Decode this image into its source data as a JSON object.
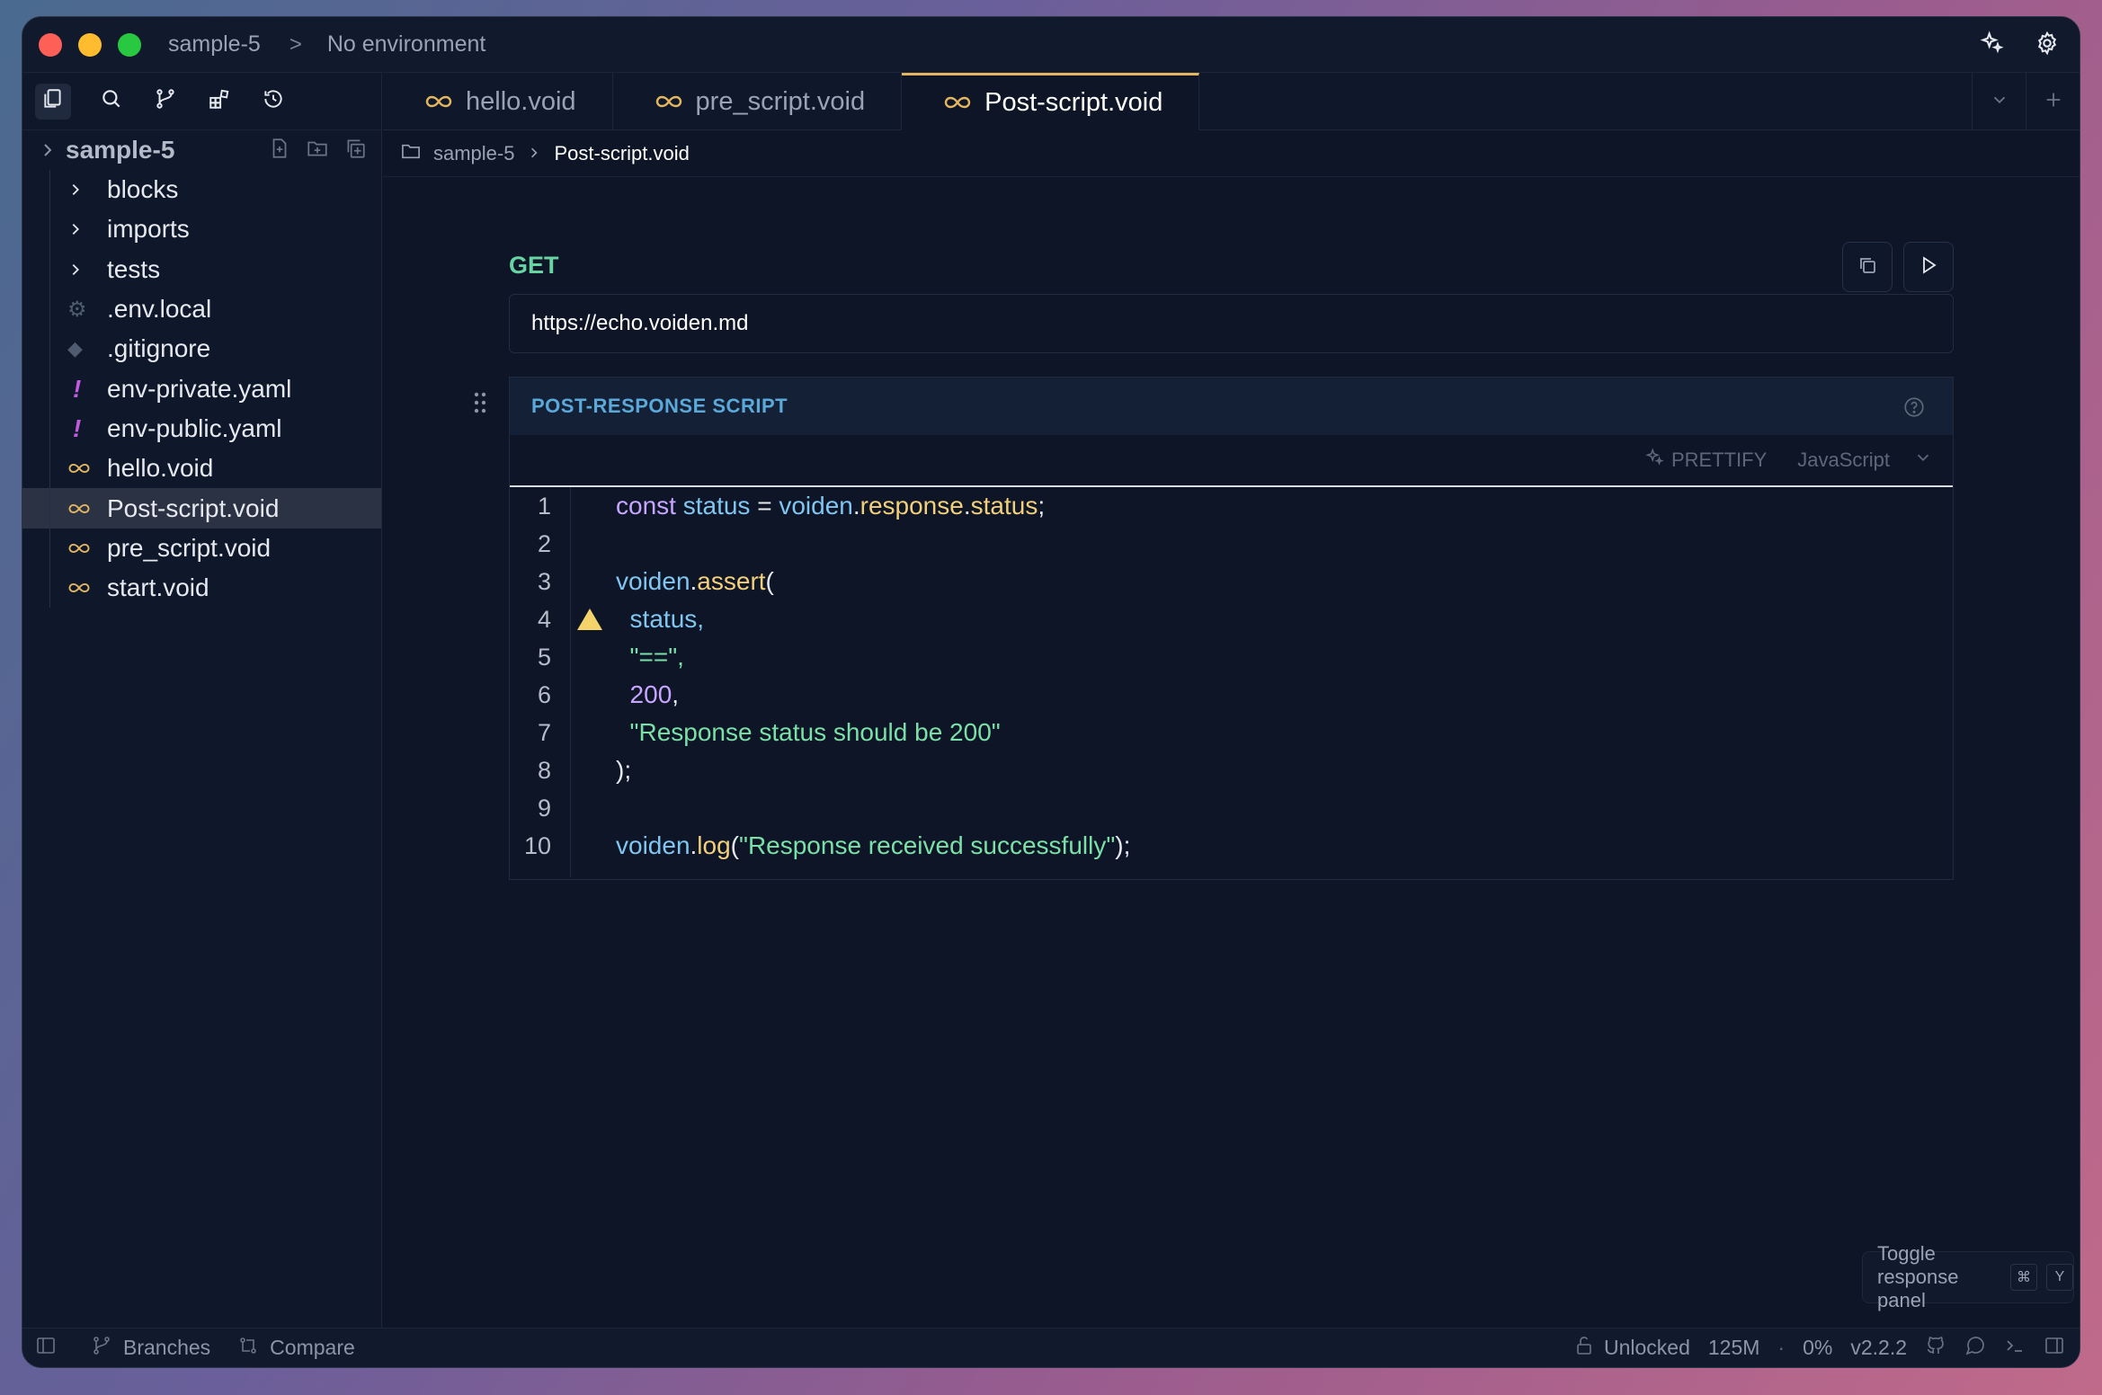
{
  "titlebar": {
    "project": "sample-5",
    "separator": ">",
    "environment": "No environment"
  },
  "sidebar": {
    "project_name": "sample-5",
    "items": [
      {
        "label": "blocks",
        "type": "folder"
      },
      {
        "label": "imports",
        "type": "folder"
      },
      {
        "label": "tests",
        "type": "folder"
      },
      {
        "label": ".env.local",
        "type": "env"
      },
      {
        "label": ".gitignore",
        "type": "git"
      },
      {
        "label": "env-private.yaml",
        "type": "yaml"
      },
      {
        "label": "env-public.yaml",
        "type": "yaml"
      },
      {
        "label": "hello.void",
        "type": "void"
      },
      {
        "label": "Post-script.void",
        "type": "void",
        "selected": true
      },
      {
        "label": "pre_script.void",
        "type": "void"
      },
      {
        "label": "start.void",
        "type": "void"
      }
    ]
  },
  "tabs": [
    {
      "label": "hello.void",
      "active": false
    },
    {
      "label": "pre_script.void",
      "active": false
    },
    {
      "label": "Post-script.void",
      "active": true
    }
  ],
  "breadcrumb": {
    "folder": "sample-5",
    "file": "Post-script.void"
  },
  "request": {
    "method": "GET",
    "url": "https://echo.voiden.md"
  },
  "script_block": {
    "title": "POST-RESPONSE SCRIPT",
    "prettify_label": "PRETTIFY",
    "language": "JavaScript",
    "line_numbers": [
      "1",
      "2",
      "3",
      "4",
      "5",
      "6",
      "7",
      "8",
      "9",
      "10"
    ],
    "code": {
      "l1": {
        "kw": "const",
        "var1": " status ",
        "eq": "= ",
        "obj": "voiden",
        "dot1": ".",
        "p1": "response",
        "dot2": ".",
        "p2": "status",
        "semi": ";"
      },
      "l3": {
        "obj": "voiden",
        "dot": ".",
        "fn": "assert",
        "paren": "("
      },
      "l4": {
        "arg": "  status,"
      },
      "l5": {
        "arg": "  \"==\","
      },
      "l6": {
        "num": "  200",
        "comma": ","
      },
      "l7": {
        "str": "  \"Response status should be 200\""
      },
      "l8": {
        "close": ");"
      },
      "l10": {
        "obj": "voiden",
        "dot": ".",
        "fn": "log",
        "open": "(",
        "str": "\"Response received successfully\"",
        "close": ");"
      }
    }
  },
  "toggle_panel": {
    "label": "Toggle response panel",
    "key1": "⌘",
    "key2": "Y"
  },
  "statusbar": {
    "branches": "Branches",
    "compare": "Compare",
    "lock": "Unlocked",
    "memory": "125M",
    "dot": "·",
    "cpu": "0%",
    "version": "v2.2.2"
  },
  "colors": {
    "accent_tab": "#e3b561",
    "method": "#67d4a4",
    "script_title": "#5aa9d9"
  }
}
